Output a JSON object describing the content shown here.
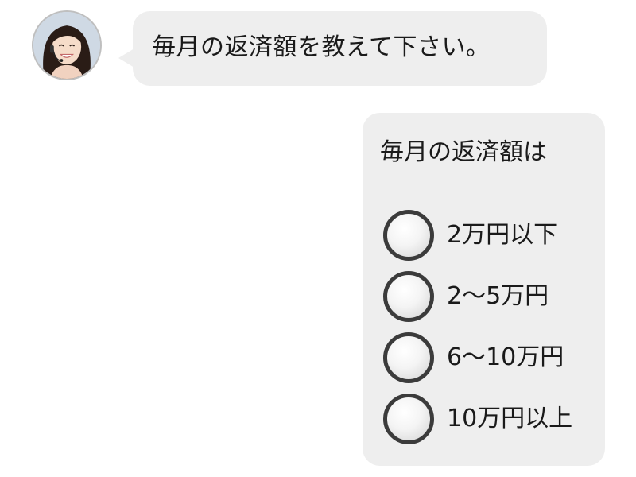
{
  "agent": {
    "avatar_icon": "operator-avatar-icon",
    "message": "毎月の返済額を教えて下さい。"
  },
  "choice_card": {
    "title": "毎月の返済額は",
    "options": [
      {
        "label": "2万円以下"
      },
      {
        "label": "2〜5万円"
      },
      {
        "label": "6〜10万円"
      },
      {
        "label": "10万円以上"
      }
    ]
  },
  "colors": {
    "bubble": "#eeeeee",
    "radio_border": "#3b3b3b",
    "background": "#ffffff"
  }
}
